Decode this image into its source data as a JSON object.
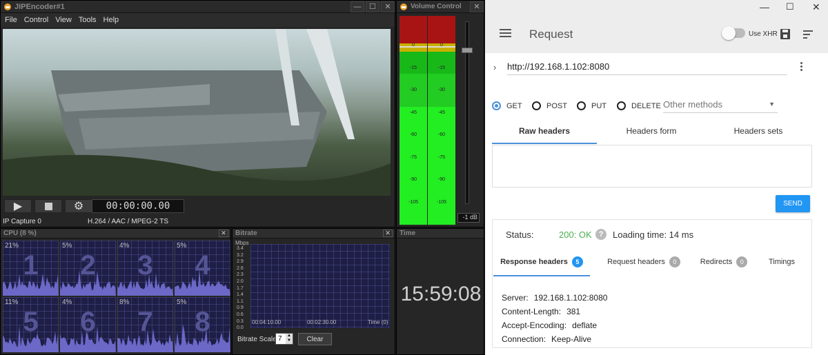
{
  "encoder": {
    "title": "JIPEncoder#1",
    "menu": [
      "File",
      "Control",
      "View",
      "Tools",
      "Help"
    ],
    "timecode": "00:00:00.00",
    "status_left": "IP Capture 0",
    "status_right": "H.264 / AAC / MPEG-2 TS"
  },
  "cpu": {
    "title": "CPU (8 %)",
    "cores": [
      {
        "n": "1",
        "pct": "21%"
      },
      {
        "n": "2",
        "pct": "5%"
      },
      {
        "n": "3",
        "pct": "4%"
      },
      {
        "n": "4",
        "pct": "5%"
      },
      {
        "n": "5",
        "pct": "11%"
      },
      {
        "n": "6",
        "pct": "4%"
      },
      {
        "n": "7",
        "pct": "8%"
      },
      {
        "n": "8",
        "pct": "5%"
      }
    ]
  },
  "bitrate": {
    "title": "Bitrate",
    "unit": "Mbps",
    "yticks": [
      "3.4",
      "3.2",
      "2.9",
      "2.6",
      "2.3",
      "2.0",
      "1.7",
      "1.4",
      "1.1",
      "0.9",
      "0.6",
      "0.3",
      "0.0"
    ],
    "xticks": [
      "00:04:10.00",
      "00:02:30.00",
      "Time (0)"
    ],
    "scale_label": "Bitrate Scale",
    "scale_value": "7",
    "clear_label": "Clear"
  },
  "volume": {
    "title": "Volume Control",
    "levels": [
      "0",
      "-15",
      "-30",
      "-45",
      "-60",
      "-75",
      "-90",
      "-105"
    ],
    "db_readout": "-1 dB"
  },
  "time": {
    "title": "Time",
    "clock": "15:59:08"
  },
  "request": {
    "title": "Request",
    "use_xhr": "Use XHR",
    "url": "http://192.168.1.102:8080",
    "methods": [
      "GET",
      "POST",
      "PUT",
      "DELETE"
    ],
    "other_methods": "Other methods",
    "header_tabs": [
      "Raw headers",
      "Headers form",
      "Headers sets"
    ],
    "send": "SEND",
    "status_label": "Status:",
    "status_value": "200: OK",
    "loading": "Loading time: 14 ms",
    "resp_tabs": [
      {
        "label": "Response headers",
        "count": "5"
      },
      {
        "label": "Request headers",
        "count": "0"
      },
      {
        "label": "Redirects",
        "count": "0"
      },
      {
        "label": "Timings",
        "count": ""
      }
    ],
    "headers": [
      {
        "k": "Server:",
        "v": "192.168.1.102:8080"
      },
      {
        "k": "Content-Length:",
        "v": "381"
      },
      {
        "k": "Accept-Encoding:",
        "v": "deflate"
      },
      {
        "k": "Connection:",
        "v": "Keep-Alive"
      }
    ],
    "colors": {
      "accent": "#2196f3",
      "ok": "#4caf50"
    }
  }
}
